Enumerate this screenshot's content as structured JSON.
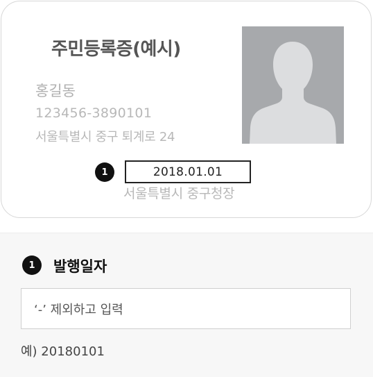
{
  "card": {
    "title": "주민등록증(예시)",
    "name": "홍길동",
    "id_number": "123456-3890101",
    "address": "서울특별시 중구 퇴계로 24",
    "issue_date": "2018.01.01",
    "issuer": "서울특별시 중구청장",
    "photo_icon": "person-silhouette-icon",
    "marker": "1"
  },
  "form": {
    "marker": "1",
    "label": "발행일자",
    "placeholder": "‘-’ 제외하고 입력",
    "example": "예) 20180101"
  }
}
